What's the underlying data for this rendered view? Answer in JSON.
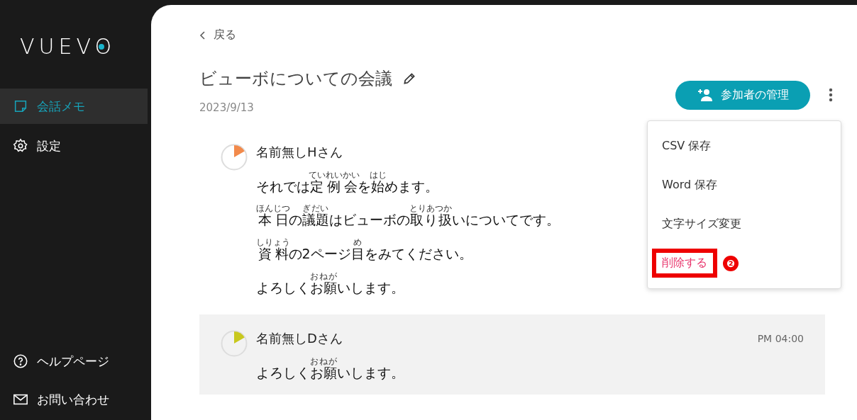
{
  "sidebar": {
    "logo": "VUEVO",
    "items": [
      {
        "label": "会話メモ",
        "selected": true
      },
      {
        "label": "設定",
        "selected": false
      }
    ],
    "bottom_items": [
      {
        "label": "ヘルプページ"
      },
      {
        "label": "お問い合わせ"
      }
    ]
  },
  "back": {
    "label": "戻る"
  },
  "meeting": {
    "title": "ビューボについての会議",
    "date": "2023/9/13"
  },
  "manage_button": {
    "label": "参加者の管理"
  },
  "menu": {
    "items": [
      {
        "label": "CSV 保存",
        "kind": "normal",
        "highlighted": false
      },
      {
        "label": "Word 保存",
        "kind": "normal",
        "highlighted": false
      },
      {
        "label": "文字サイズ変更",
        "kind": "normal",
        "highlighted": false
      },
      {
        "label": "削除する",
        "kind": "danger",
        "highlighted": true
      }
    ],
    "annotation": "❷"
  },
  "messages": [
    {
      "speaker": "名前無しHさん",
      "color": "#f28a4b",
      "highlighted": false,
      "lines": [
        [
          {
            "text": "それでは"
          },
          {
            "text": "定例会",
            "ruby": "ていれいかい"
          },
          {
            "text": "を"
          },
          {
            "text": "始",
            "ruby": "はじ"
          },
          {
            "text": "めます。"
          }
        ],
        [
          {
            "text": "本日",
            "ruby": "ほんじつ"
          },
          {
            "text": "の"
          },
          {
            "text": "議題",
            "ruby": "ぎだい"
          },
          {
            "text": "はビューボの"
          },
          {
            "text": "取り扱",
            "ruby": "とりあつか"
          },
          {
            "text": "いについてです。"
          }
        ],
        [
          {
            "text": "資料",
            "ruby": "しりょう"
          },
          {
            "text": "の2ページ"
          },
          {
            "text": "目",
            "ruby": "め"
          },
          {
            "text": "をみてください。"
          }
        ],
        [
          {
            "text": "よろしく"
          },
          {
            "text": "お願",
            "ruby": "おねが"
          },
          {
            "text": "いします。"
          }
        ]
      ]
    },
    {
      "speaker": "名前無しDさん",
      "color": "#c8c81e",
      "highlighted": true,
      "time": "PM 04:00",
      "lines": [
        [
          {
            "text": "よろしく"
          },
          {
            "text": "お願",
            "ruby": "おねが"
          },
          {
            "text": "いします。"
          }
        ]
      ]
    }
  ]
}
